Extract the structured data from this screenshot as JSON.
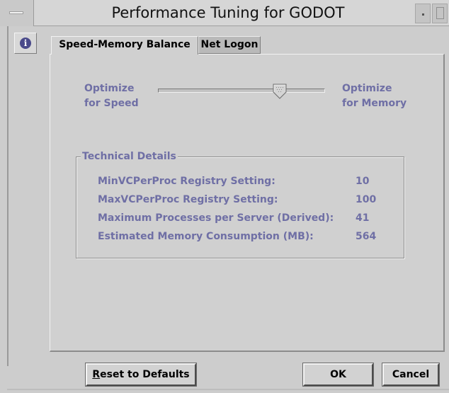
{
  "window": {
    "title": "Performance Tuning for GODOT"
  },
  "tabs": [
    {
      "label": "Speed-Memory Balance",
      "active": true
    },
    {
      "label": "Net Logon",
      "active": false
    }
  ],
  "slider": {
    "left_label_line1": "Optimize",
    "left_label_line2": "for Speed",
    "right_label_line1": "Optimize",
    "right_label_line2": "for Memory",
    "position_fraction": 0.75
  },
  "technical_details": {
    "title": "Technical Details",
    "rows": [
      {
        "label": "MinVCPerProc Registry Setting:",
        "value": "10"
      },
      {
        "label": "MaxVCPerProc Registry Setting:",
        "value": "100"
      },
      {
        "label": "Maximum Processes per Server (Derived):",
        "value": "41"
      },
      {
        "label": "Estimated Memory Consumption (MB):",
        "value": "564"
      }
    ]
  },
  "buttons": {
    "reset_first": "R",
    "reset_rest": "eset to Defaults",
    "ok": "OK",
    "cancel": "Cancel"
  },
  "colors": {
    "disabled_text": "#6f6fa5",
    "window_bg": "#cdcdcd"
  },
  "icons": {
    "info": "info-icon"
  }
}
